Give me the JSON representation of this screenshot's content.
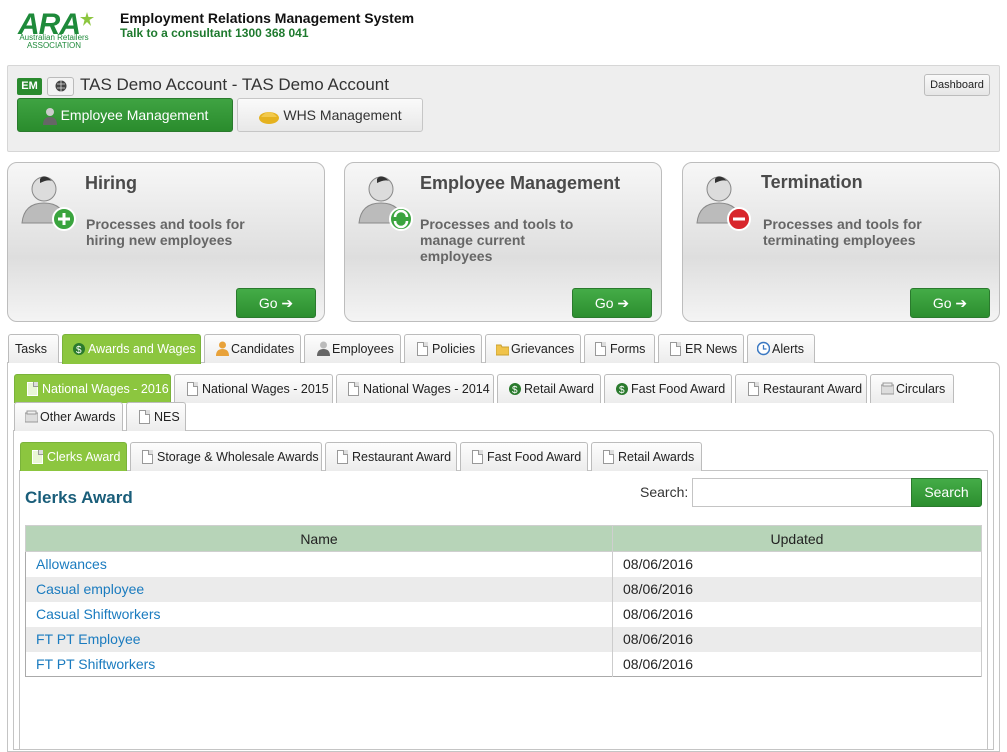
{
  "header": {
    "logo_text": "ARA",
    "logo_sub": "Australian Retailers ASSOCIATION",
    "system_title": "Employment Relations Management System",
    "phone_text": "Talk to a consultant 1300 368 041"
  },
  "account": {
    "badge": "EM",
    "title": "TAS Demo Account - TAS Demo Account",
    "dashboard_label": "Dashboard",
    "modules": [
      {
        "label": "Employee Management",
        "icon": "person-icon",
        "active": true
      },
      {
        "label": "WHS Management",
        "icon": "hard-hat-icon",
        "active": false
      }
    ]
  },
  "cards": [
    {
      "title": "Hiring",
      "desc": "Processes and tools for hiring new employees",
      "go": "Go ➔",
      "icon": "add-person-icon",
      "badge_color": "#3aa43e"
    },
    {
      "title": "Employee Management",
      "desc": "Processes and tools to manage current employees",
      "go": "Go ➔",
      "icon": "refresh-person-icon",
      "badge_color": "#3aa43e"
    },
    {
      "title": "Termination",
      "desc": "Processes and tools for terminating employees",
      "go": "Go ➔",
      "icon": "remove-person-icon",
      "badge_color": "#d8262c"
    }
  ],
  "main_tabs": [
    "Tasks",
    "Awards and Wages",
    "Candidates",
    "Employees",
    "Policies",
    "Grievances",
    "Forms",
    "ER News",
    "Alerts"
  ],
  "sub_tabs": [
    "National Wages - 2016",
    "National Wages - 2015",
    "National Wages - 2014",
    "Retail Award",
    "Fast Food Award",
    "Restaurant Award",
    "Circulars",
    "Other Awards",
    "NES"
  ],
  "award_tabs": [
    "Clerks Award",
    "Storage & Wholesale Awards",
    "Restaurant Award",
    "Fast Food Award",
    "Retail Awards"
  ],
  "content": {
    "section_title": "Clerks Award",
    "search_label": "Search:",
    "search_value": "",
    "search_button": "Search",
    "columns": [
      "Name",
      "Updated"
    ],
    "rows": [
      {
        "name": "Allowances",
        "updated": "08/06/2016"
      },
      {
        "name": "Casual employee",
        "updated": "08/06/2016"
      },
      {
        "name": "Casual Shiftworkers",
        "updated": "08/06/2016"
      },
      {
        "name": "FT PT Employee",
        "updated": "08/06/2016"
      },
      {
        "name": "FT PT Shiftworkers",
        "updated": "08/06/2016"
      }
    ]
  },
  "colors": {
    "brand_green": "#2a8c2d",
    "tab_active": "#8cc63f",
    "link": "#1a7bbf",
    "title_blue": "#1a5e7a"
  }
}
